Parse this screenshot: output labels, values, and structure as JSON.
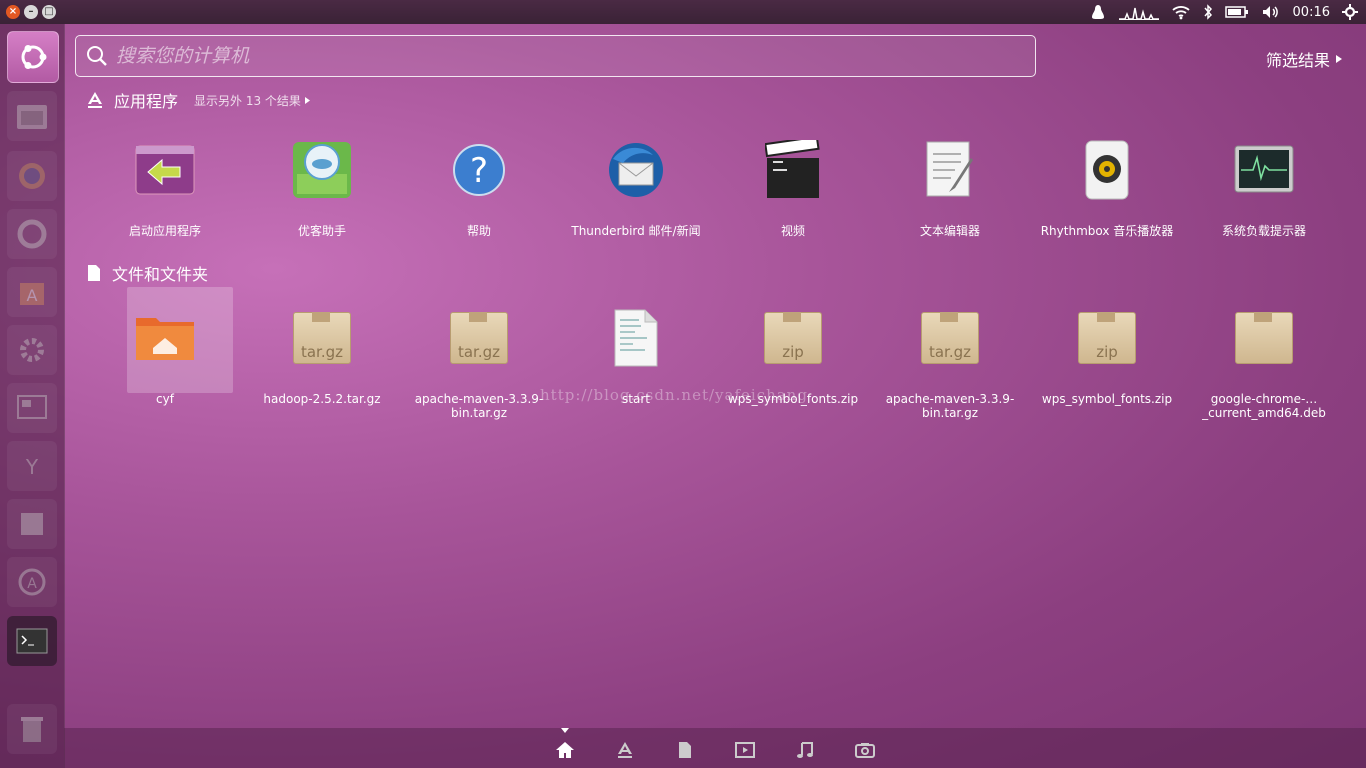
{
  "top_panel": {
    "clock": "00:16"
  },
  "search": {
    "placeholder": "搜索您的计算机"
  },
  "filter_label": "筛选结果",
  "sections": {
    "apps": {
      "title": "应用程序",
      "more": "显示另外 13 个结果",
      "items": [
        {
          "label": "启动应用程序",
          "icon": "startup-applications-icon"
        },
        {
          "label": "优客助手",
          "icon": "ubuntu-kylin-assistant-icon"
        },
        {
          "label": "帮助",
          "icon": "help-icon"
        },
        {
          "label": "Thunderbird 邮件/新闻",
          "icon": "thunderbird-icon"
        },
        {
          "label": "视频",
          "icon": "video-clapper-icon"
        },
        {
          "label": "文本编辑器",
          "icon": "text-editor-icon"
        },
        {
          "label": "Rhythmbox 音乐播放器",
          "icon": "rhythmbox-speaker-icon"
        },
        {
          "label": "系统负载提示器",
          "icon": "system-monitor-icon"
        }
      ]
    },
    "files": {
      "title": "文件和文件夹",
      "items": [
        {
          "label": "cyf",
          "icon": "home-folder-icon"
        },
        {
          "label": "hadoop-2.5.2.tar.gz",
          "icon": "archive-icon",
          "badge": "tar.gz"
        },
        {
          "label": "apache-maven-3.3.9-bin.tar.gz",
          "icon": "archive-icon",
          "badge": "tar.gz"
        },
        {
          "label": "start",
          "icon": "text-file-icon"
        },
        {
          "label": "wps_symbol_fonts.zip",
          "icon": "archive-icon",
          "badge": "zip"
        },
        {
          "label": "apache-maven-3.3.9-bin.tar.gz",
          "icon": "archive-icon",
          "badge": "tar.gz"
        },
        {
          "label": "wps_symbol_fonts.zip",
          "icon": "archive-icon",
          "badge": "zip"
        },
        {
          "label": "google-chrome-…_current_amd64.deb",
          "icon": "archive-icon",
          "badge": ""
        }
      ]
    }
  },
  "watermark": "http://blog.csdn.net/yafeichang",
  "colors": {
    "accent_orange": "#e25822",
    "dash_purple": "#a8559a"
  }
}
